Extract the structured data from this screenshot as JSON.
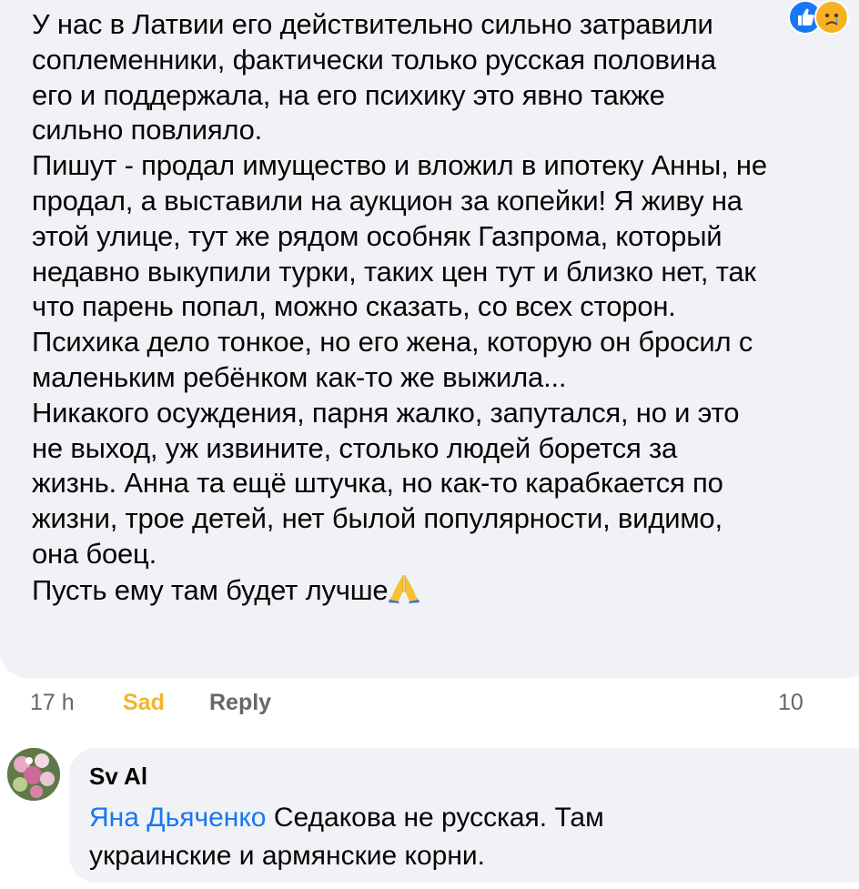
{
  "comment1": {
    "lines": [
      "У нас в Латвии его действительно сильно затравили",
      "соплеменники, фактически только русская половина",
      "его и поддержала, на его психику это явно также",
      "сильно повлияло.",
      "Пишут - продал имущество и вложил в ипотеку Анны, не",
      "продал, а выставили на аукцион за копейки! Я живу на",
      "этой улице, тут же рядом особняк Газпрома, который",
      "недавно выкупили турки, таких цен тут и близко нет, так",
      "что парень попал, можно сказать, со всех сторон.",
      "Психика дело тонкое, но его жена, которую он бросил с",
      "маленьким ребёнком как-то же выжила...",
      "Никакого осуждения, парня жалко, запутался, но и это",
      "не выход, уж извините, столько людей борется за",
      "жизнь. Анна та ещё штучка, но как-то карабкается по",
      "жизни, трое детей, нет былой популярности, видимо,",
      "она боец.",
      "Пусть ему там будет лучше"
    ],
    "emoji": "praying-hands-icon"
  },
  "actions": {
    "time": "17 h",
    "reaction": "Sad",
    "reply": "Reply",
    "count": "10",
    "reaction_icons": [
      "like-icon",
      "sad-face-icon"
    ],
    "colors": {
      "sad": "#f0b62b",
      "like": "#1877f2",
      "muted": "#65676b"
    }
  },
  "comment2": {
    "author": "Sv Al",
    "mention": "Яна Дьяченко",
    "text_line1": " Седакова не русская. Там",
    "text_line2": "украинские и армянские корни.",
    "avatar_icon": "flower-avatar-icon"
  }
}
